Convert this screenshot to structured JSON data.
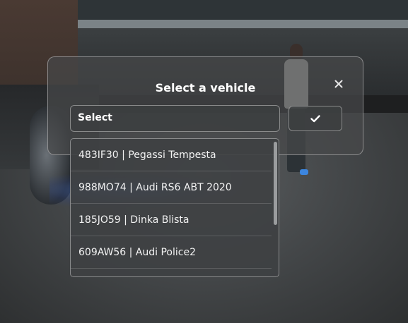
{
  "dialog": {
    "title": "Select a vehicle",
    "close_icon": "close-icon",
    "select": {
      "value": "Select"
    },
    "confirm_icon": "checkmark-icon"
  },
  "dropdown": {
    "items": [
      {
        "label": "483IF30 | Pegassi Tempesta"
      },
      {
        "label": "988MO74 | Audi RS6 ABT 2020"
      },
      {
        "label": "185JO59 | Dinka Blista"
      },
      {
        "label": "609AW56 | Audi Police2"
      },
      {
        "label": ""
      }
    ],
    "scroll_position": 0.0
  },
  "colors": {
    "panel_bg": "#46484a",
    "panel_border": "#c8c8c8",
    "text": "#ffffff"
  }
}
